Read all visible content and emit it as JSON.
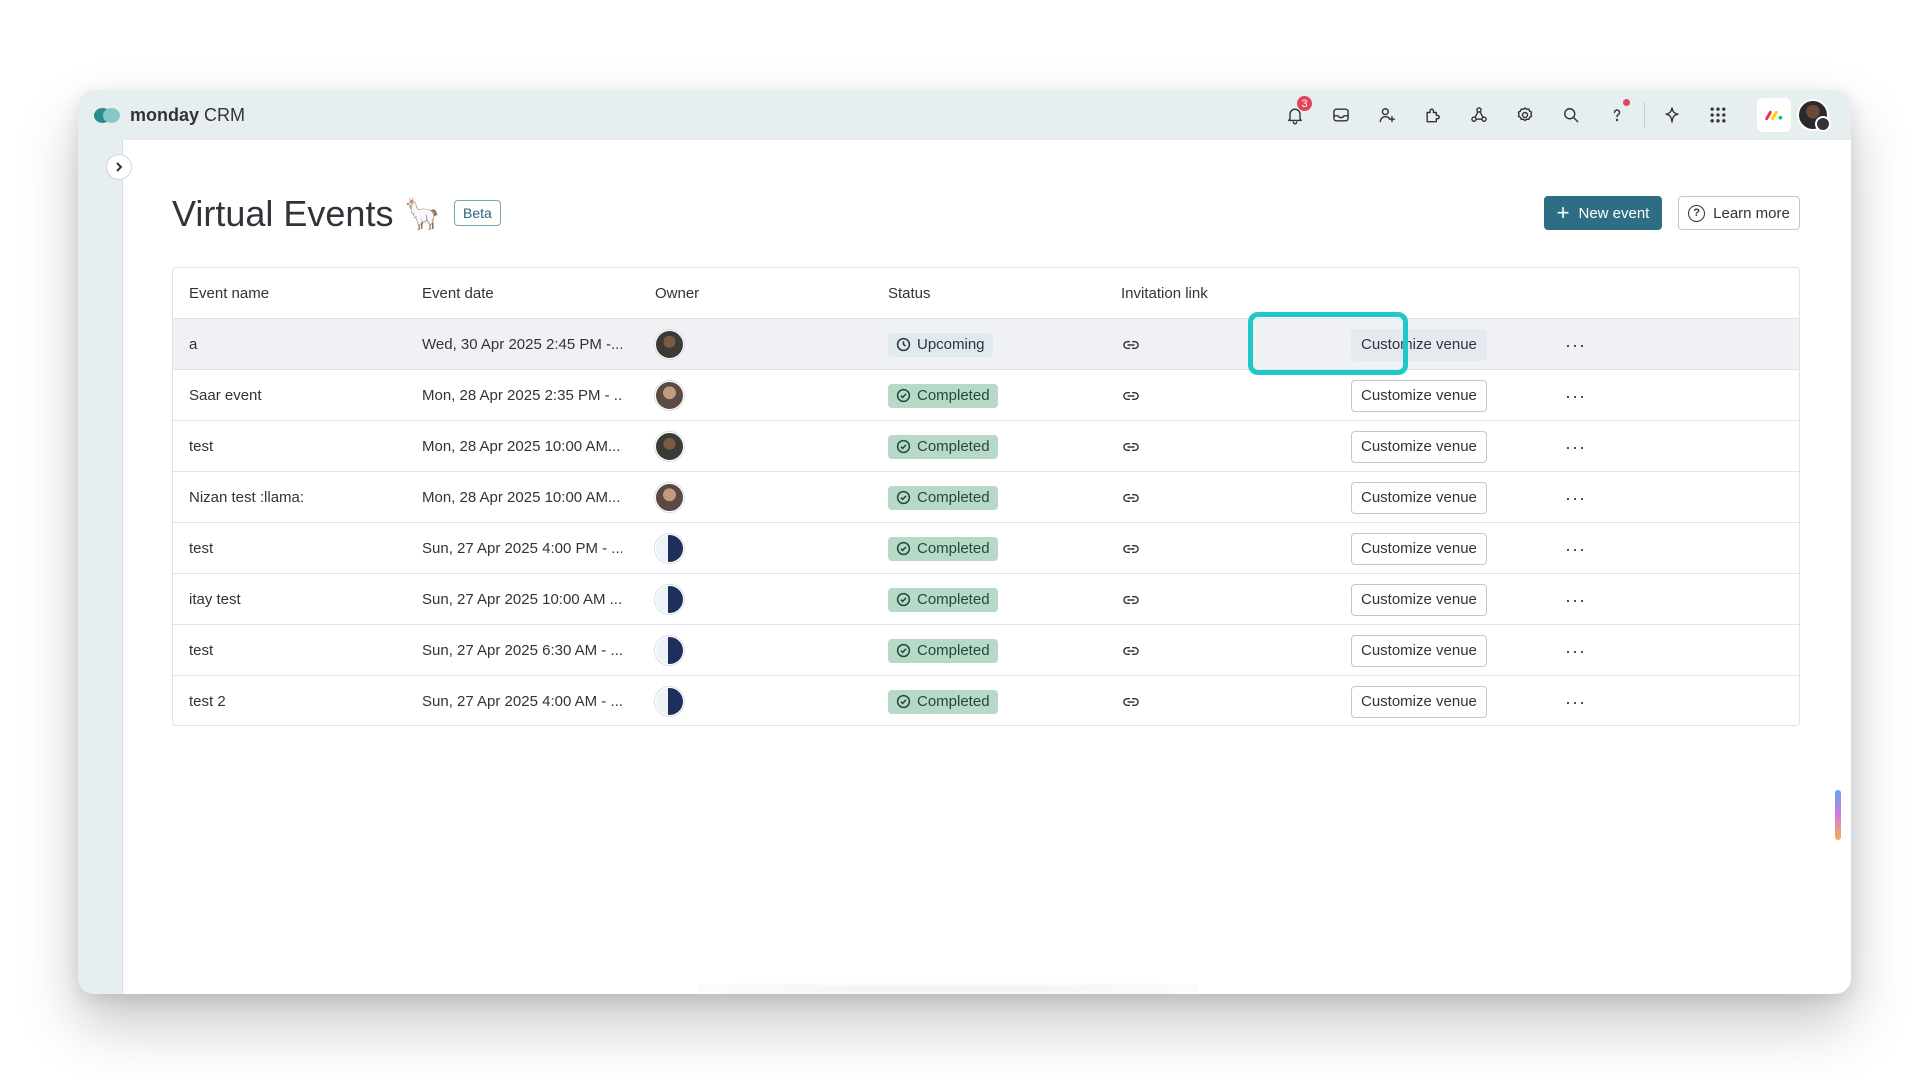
{
  "app": {
    "brand_name": "monday",
    "brand_sub": "CRM"
  },
  "topbar": {
    "notifications_count": "3",
    "icons": [
      "bell-icon",
      "inbox-icon",
      "invite-members-icon",
      "apps-icon",
      "integrations-icon",
      "settings-icon",
      "search-icon",
      "help-icon",
      "ai-sparkle-icon",
      "app-switcher-icon"
    ]
  },
  "page": {
    "title": "Virtual Events",
    "title_emoji": "🦙",
    "badge": "Beta",
    "new_event_label": "New event",
    "learn_more_label": "Learn more"
  },
  "table": {
    "columns": [
      "Event name",
      "Event date",
      "Owner",
      "Status",
      "Invitation link"
    ],
    "customize_label": "Customize venue",
    "rows": [
      {
        "name": "a",
        "date": "Wed, 30 Apr 2025 2:45 PM -...",
        "status": "Upcoming"
      },
      {
        "name": "Saar event",
        "date": "Mon, 28 Apr 2025 2:35 PM - ...",
        "status": "Completed"
      },
      {
        "name": "test",
        "date": "Mon, 28 Apr 2025 10:00 AM...",
        "status": "Completed"
      },
      {
        "name": "Nizan test :llama:",
        "date": "Mon, 28 Apr 2025 10:00 AM...",
        "status": "Completed"
      },
      {
        "name": "test",
        "date": "Sun, 27 Apr 2025 4:00 PM - ...",
        "status": "Completed"
      },
      {
        "name": "itay test",
        "date": "Sun, 27 Apr 2025 10:00 AM ...",
        "status": "Completed"
      },
      {
        "name": "test",
        "date": "Sun, 27 Apr 2025 6:30 AM - ...",
        "status": "Completed"
      },
      {
        "name": "test 2",
        "date": "Sun, 27 Apr 2025 4:00 AM - ...",
        "status": "Completed"
      }
    ]
  },
  "colors": {
    "accent": "#2e6e84",
    "completed_bg": "#b8d8c8",
    "upcoming_bg": "#dfe9ee",
    "focus_ring": "#1fc8c8",
    "notification_badge": "#e2445c"
  }
}
